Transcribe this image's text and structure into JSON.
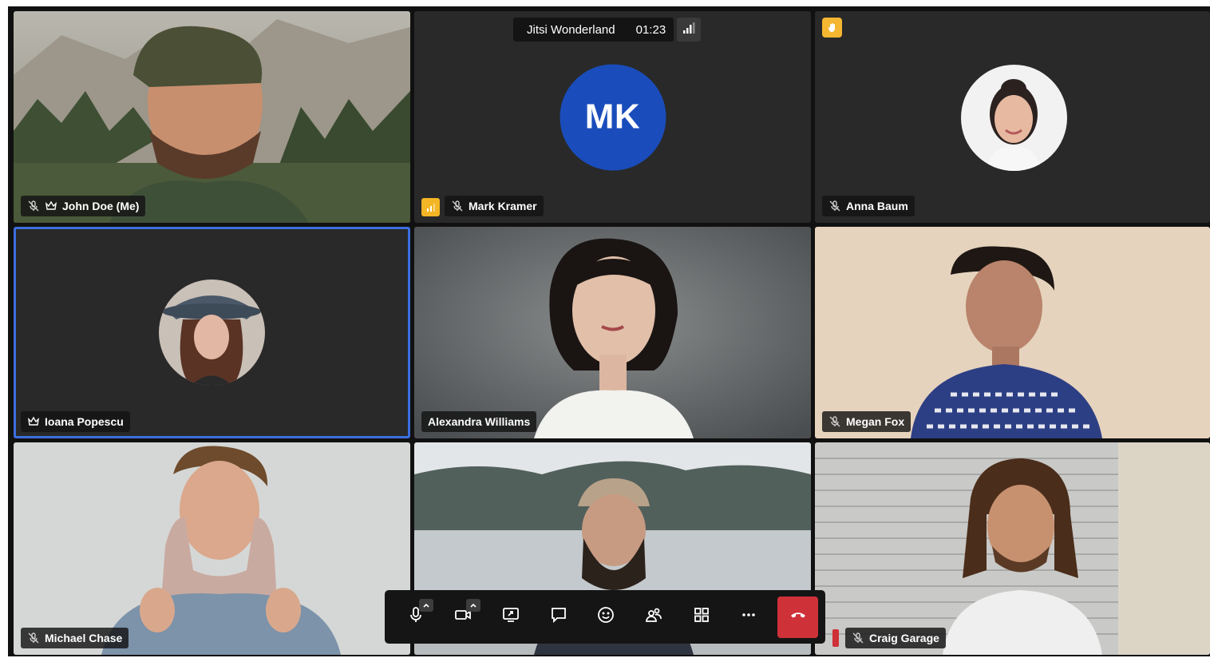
{
  "meeting": {
    "title": "Jitsi Wonderland",
    "timer": "01:23"
  },
  "participants": [
    {
      "name": "John Doe (Me)",
      "muted": true,
      "moderator": true
    },
    {
      "name": "Mark Kramer",
      "initials": "MK",
      "muted": true,
      "moderator": false,
      "connection": "poor"
    },
    {
      "name": "Anna Baum",
      "muted": true,
      "moderator": false,
      "hand_raised": true
    },
    {
      "name": "Ioana Popescu",
      "muted": false,
      "moderator": true,
      "active_speaker": true
    },
    {
      "name": "Alexandra Williams",
      "muted": false,
      "moderator": false
    },
    {
      "name": "Megan Fox",
      "muted": true,
      "moderator": false
    },
    {
      "name": "Michael Chase",
      "muted": true,
      "moderator": false
    },
    {
      "name": "",
      "muted": false,
      "moderator": false
    },
    {
      "name": "Craig Garage",
      "muted": true,
      "moderator": false
    }
  ],
  "toolbar": {
    "buttons": [
      "microphone",
      "camera",
      "share-screen",
      "chat",
      "reactions",
      "participants",
      "tile-view",
      "more",
      "leave"
    ]
  },
  "colors": {
    "tile_bg": "#292929",
    "active_outline": "#3b6ee0",
    "avatar_blue": "#1a4dbb",
    "raise_hand": "#f5b731",
    "hangup": "#cf3138"
  }
}
